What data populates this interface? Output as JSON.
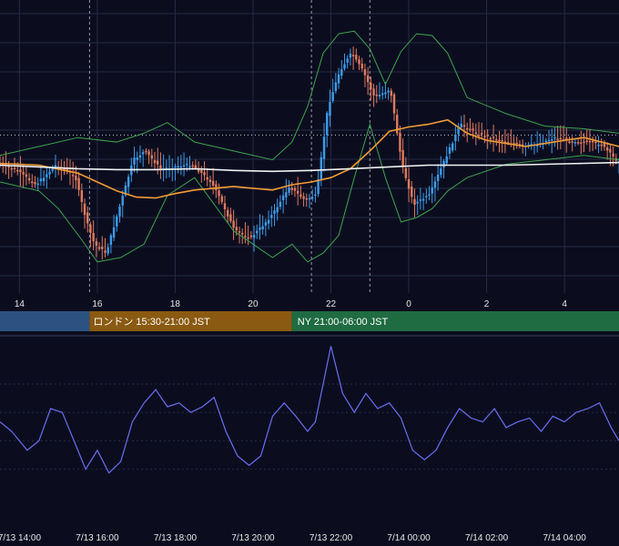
{
  "colors": {
    "background": "#0b0d1f",
    "grid": "#262a44",
    "candle_up": "#3d9be9",
    "candle_down": "#e07a5f",
    "bollinger": "#3fa34d",
    "ma_fast": "#f39c34",
    "ma_slow": "#f2f2f2",
    "indicator": "#6a6ff0",
    "session_tokyo": "#2c5282",
    "session_london": "#8a5a12",
    "session_ny": "#1f6b42"
  },
  "sessions": [
    {
      "name": "tokyo",
      "label": "",
      "start": 13.5,
      "end": 15.8
    },
    {
      "name": "london",
      "label": "ロンドン 15:30-21:00 JST",
      "start": 15.8,
      "end": 21.0
    },
    {
      "name": "ny",
      "label": "NY 21:00-06:00 JST",
      "start": 21.0,
      "end": 29.4
    }
  ],
  "chart_data": [
    {
      "type": "candlestick",
      "x_ticks": [
        "14",
        "16",
        "18",
        "20",
        "22",
        "0",
        "2",
        "4"
      ],
      "x_tick_hours": [
        14,
        16,
        18,
        20,
        22,
        24,
        26,
        28
      ],
      "x_range": [
        13.5,
        29.4
      ],
      "vertical_markers": [
        15.8,
        21.5,
        23.0
      ],
      "reference_level": 152,
      "y_range": [
        0,
        330
      ],
      "series": [
        {
          "kind": "price",
          "x": [
            13.5,
            14.0,
            14.5,
            15.0,
            15.5,
            15.8,
            16.0,
            16.3,
            16.6,
            17.0,
            17.3,
            17.7,
            18.0,
            18.5,
            19.0,
            19.3,
            19.6,
            20.0,
            20.3,
            20.6,
            21.0,
            21.4,
            21.7,
            22.0,
            22.3,
            22.6,
            22.9,
            23.2,
            23.6,
            23.9,
            24.2,
            24.6,
            25.0,
            25.4,
            25.8,
            26.2,
            26.6,
            27.0,
            27.4,
            27.8,
            28.2,
            28.6,
            29.0,
            29.4
          ],
          "y": [
            184,
            192,
            208,
            186,
            198,
            250,
            275,
            285,
            240,
            180,
            170,
            190,
            188,
            185,
            205,
            230,
            260,
            268,
            255,
            240,
            210,
            225,
            220,
            120,
            80,
            60,
            80,
            110,
            100,
            185,
            230,
            220,
            180,
            140,
            150,
            155,
            160,
            165,
            162,
            155,
            158,
            160,
            162,
            180
          ]
        },
        {
          "kind": "bb_upper",
          "x": [
            13.5,
            14.5,
            15.5,
            16.5,
            17.2,
            17.8,
            18.5,
            19.5,
            20.5,
            21.0,
            21.4,
            21.8,
            22.2,
            22.6,
            23.0,
            23.4,
            23.8,
            24.2,
            24.6,
            25.0,
            25.5,
            26.5,
            27.5,
            28.5,
            29.4
          ],
          "y": [
            175,
            165,
            155,
            160,
            150,
            138,
            160,
            170,
            180,
            160,
            120,
            60,
            38,
            35,
            55,
            95,
            58,
            38,
            40,
            60,
            110,
            128,
            142,
            145,
            150
          ]
        },
        {
          "kind": "bb_lower",
          "x": [
            13.5,
            14.5,
            15.0,
            15.6,
            16.0,
            16.6,
            17.2,
            17.8,
            18.5,
            19.5,
            20.5,
            21.0,
            21.4,
            21.8,
            22.2,
            22.6,
            23.0,
            23.4,
            23.8,
            24.2,
            24.6,
            25.0,
            25.5,
            26.5,
            27.5,
            28.5,
            29.4
          ],
          "y": [
            205,
            215,
            235,
            270,
            295,
            290,
            275,
            220,
            200,
            260,
            290,
            275,
            295,
            285,
            265,
            200,
            140,
            200,
            250,
            245,
            235,
            215,
            200,
            185,
            180,
            175,
            180
          ]
        },
        {
          "kind": "ma_fast",
          "x": [
            13.5,
            14.5,
            15.5,
            16.0,
            16.5,
            17.0,
            17.5,
            18.0,
            18.5,
            19.0,
            19.5,
            20.0,
            20.5,
            21.0,
            21.5,
            22.0,
            22.5,
            23.0,
            23.5,
            24.0,
            24.5,
            25.0,
            25.5,
            26.0,
            27.0,
            28.0,
            28.5,
            29.4
          ],
          "y": [
            184,
            186,
            195,
            205,
            215,
            222,
            223,
            218,
            214,
            212,
            210,
            212,
            214,
            208,
            205,
            200,
            190,
            170,
            148,
            143,
            140,
            135,
            150,
            158,
            165,
            158,
            155,
            165
          ]
        },
        {
          "kind": "ma_slow",
          "x": [
            13.5,
            14.5,
            15.5,
            16.5,
            17.5,
            18.5,
            19.5,
            20.5,
            21.5,
            22.5,
            23.5,
            24.5,
            25.5,
            26.5,
            27.5,
            28.5,
            29.4
          ],
          "y": [
            186,
            188,
            190,
            191,
            191,
            190,
            192,
            193,
            192,
            190,
            188,
            186,
            186,
            186,
            185,
            184,
            183
          ]
        }
      ]
    },
    {
      "type": "line",
      "name": "",
      "x_ticks": [
        "7/13 14:00",
        "7/13 16:00",
        "7/13 18:00",
        "7/13 20:00",
        "7/13 22:00",
        "7/14 00:00",
        "7/14 02:00",
        "7/14 04:00"
      ],
      "x_tick_hours": [
        14,
        16,
        18,
        20,
        22,
        24,
        26,
        28
      ],
      "x_range": [
        13.5,
        29.4
      ],
      "y_range": [
        0,
        100
      ],
      "gridlines": [
        30,
        45,
        60,
        75
      ],
      "series": [
        {
          "x": [
            13.5,
            13.8,
            14.2,
            14.5,
            14.8,
            15.1,
            15.4,
            15.7,
            16.0,
            16.3,
            16.6,
            16.9,
            17.2,
            17.5,
            17.8,
            18.1,
            18.4,
            18.7,
            19.0,
            19.3,
            19.6,
            19.9,
            20.2,
            20.5,
            20.8,
            21.1,
            21.4,
            21.6,
            21.8,
            22.0,
            22.3,
            22.6,
            22.9,
            23.2,
            23.5,
            23.8,
            24.1,
            24.4,
            24.7,
            25.0,
            25.3,
            25.6,
            25.9,
            26.2,
            26.5,
            26.8,
            27.1,
            27.4,
            27.7,
            28.0,
            28.3,
            28.6,
            28.9,
            29.2,
            29.4
          ],
          "y": [
            55,
            50,
            40,
            45,
            62,
            60,
            45,
            30,
            40,
            28,
            34,
            55,
            65,
            72,
            63,
            65,
            60,
            63,
            68,
            50,
            37,
            32,
            37,
            58,
            65,
            58,
            50,
            55,
            75,
            95,
            70,
            60,
            70,
            62,
            65,
            57,
            40,
            35,
            40,
            52,
            62,
            57,
            55,
            62,
            52,
            55,
            57,
            50,
            58,
            55,
            60,
            62,
            65,
            52,
            45
          ]
        }
      ]
    }
  ]
}
